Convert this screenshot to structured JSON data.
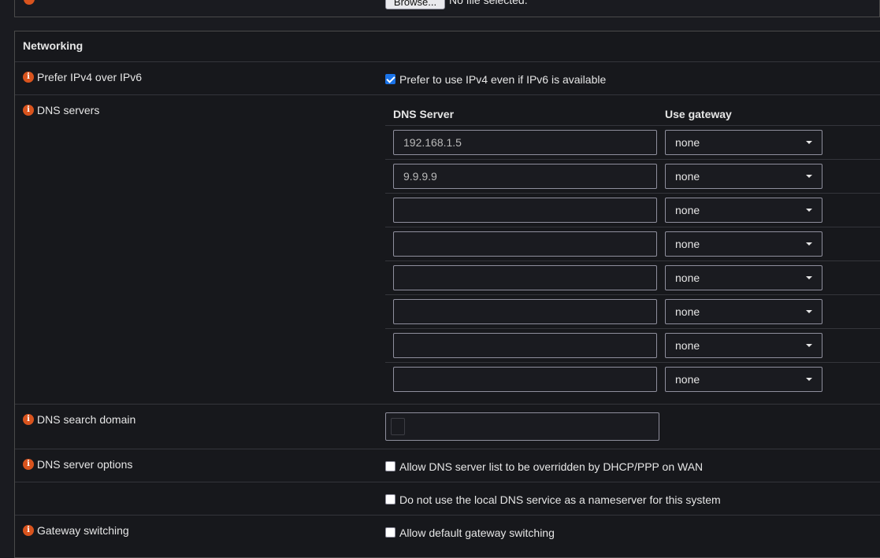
{
  "top": {
    "browse_label": "Browse...",
    "no_file": "No file selected."
  },
  "section": {
    "title": "Networking"
  },
  "prefer_ipv4": {
    "label": "Prefer IPv4 over IPv6",
    "checkbox_label": "Prefer to use IPv4 even if IPv6 is available",
    "checked": true
  },
  "dns_servers": {
    "label": "DNS servers",
    "col_server": "DNS Server",
    "col_gateway": "Use gateway",
    "rows": [
      {
        "server": "192.168.1.5",
        "gateway": "none"
      },
      {
        "server": "9.9.9.9",
        "gateway": "none"
      },
      {
        "server": "",
        "gateway": "none"
      },
      {
        "server": "",
        "gateway": "none"
      },
      {
        "server": "",
        "gateway": "none"
      },
      {
        "server": "",
        "gateway": "none"
      },
      {
        "server": "",
        "gateway": "none"
      },
      {
        "server": "",
        "gateway": "none"
      }
    ]
  },
  "dns_search": {
    "label": "DNS search domain",
    "value": ""
  },
  "dns_options": {
    "label": "DNS server options",
    "option1": "Allow DNS server list to be overridden by DHCP/PPP on WAN",
    "option2": "Do not use the local DNS service as a nameserver for this system"
  },
  "gateway_switching": {
    "label": "Gateway switching",
    "checkbox_label": "Allow default gateway switching"
  },
  "colors": {
    "accent": "#d9541e",
    "checkbox_on": "#1a73e8"
  },
  "icons": {
    "info": "info-icon",
    "dropdown": "chevron-down-icon"
  }
}
